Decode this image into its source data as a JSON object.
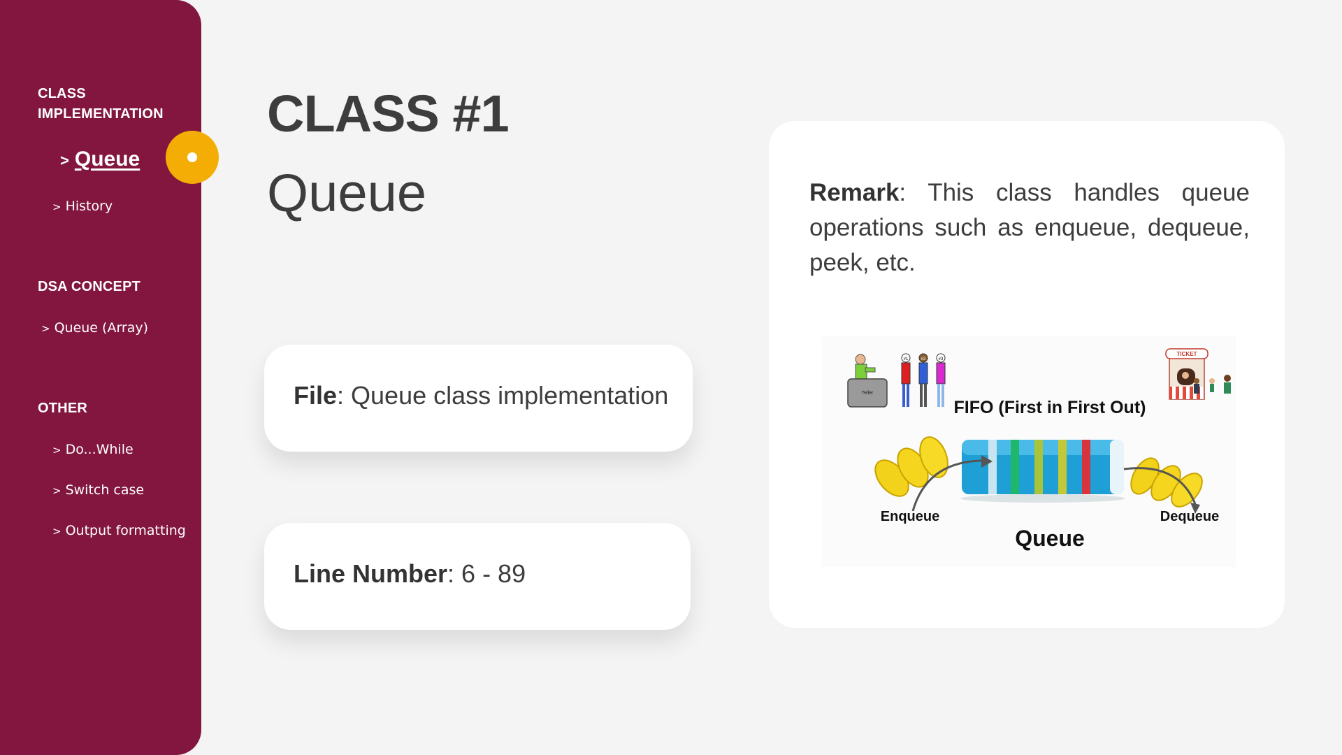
{
  "sidebar": {
    "sections": [
      {
        "title": "CLASS\nIMPLEMENTATION"
      },
      {
        "title": "DSA CONCEPT"
      },
      {
        "title": "OTHER"
      }
    ],
    "active_item": {
      "chevron": ">",
      "label": "Queue"
    },
    "items": [
      {
        "chevron": ">",
        "label": "History"
      },
      {
        "chevron": ">",
        "label": "Queue (Array)"
      },
      {
        "chevron": ">",
        "label": "Do...While"
      },
      {
        "chevron": ">",
        "label": "Switch case"
      },
      {
        "chevron": ">",
        "label": "Output formatting"
      }
    ],
    "accent_color": "#f4ad05",
    "background_color": "#82163e"
  },
  "header": {
    "title": "CLASS #1",
    "subtitle": "Queue"
  },
  "file_card": {
    "label": "File",
    "value": "Queue class implementation"
  },
  "line_card": {
    "label": "Line Number",
    "value": "6 - 89"
  },
  "remark": {
    "label": "Remark",
    "text": "This class handles queue operations such as enqueue, dequeue, peek, etc."
  },
  "illustration": {
    "teller_label": "Teller",
    "ticket_label": "TICKET",
    "fifo_label": "FIFO (First in First Out)",
    "enqueue_label": "Enqueue",
    "dequeue_label": "Dequeue",
    "queue_label": "Queue",
    "person_labels": [
      "#1",
      "#2",
      "#3"
    ]
  }
}
